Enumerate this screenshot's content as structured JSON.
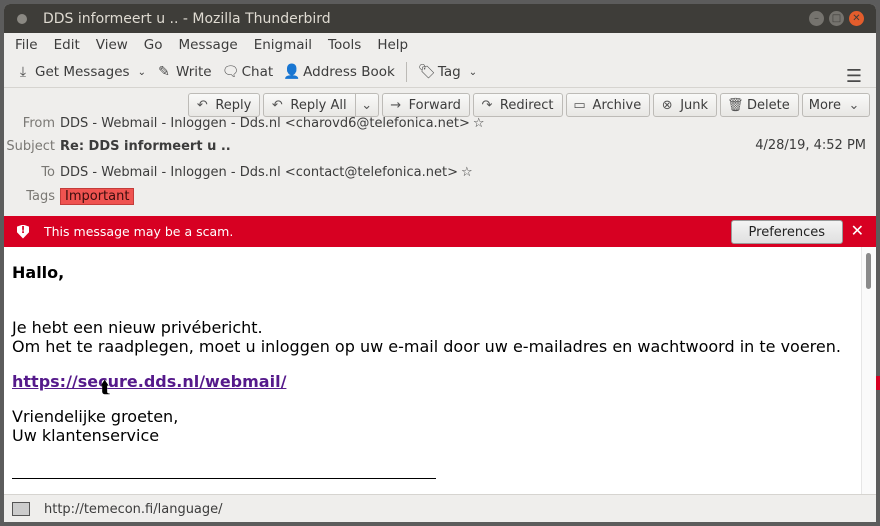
{
  "window": {
    "title": "DDS informeert u .. - Mozilla Thunderbird"
  },
  "menu": [
    "File",
    "Edit",
    "View",
    "Go",
    "Message",
    "Enigmail",
    "Tools",
    "Help"
  ],
  "toolbar": {
    "get_messages": "Get Messages",
    "write": "Write",
    "chat": "Chat",
    "address_book": "Address Book",
    "tag": "Tag"
  },
  "actions": {
    "reply": "Reply",
    "reply_all": "Reply All",
    "forward": "Forward",
    "redirect": "Redirect",
    "archive": "Archive",
    "junk": "Junk",
    "delete": "Delete",
    "more": "More"
  },
  "headers": {
    "from_label": "From",
    "from_value": "DDS - Webmail - Inloggen - Dds.nl <charovd6@telefonica.net>",
    "subject_label": "Subject",
    "subject_value": "Re: DDS informeert u ..",
    "date": "4/28/19, 4:52 PM",
    "to_label": "To",
    "to_value": "DDS - Webmail - Inloggen - Dds.nl <contact@telefonica.net>",
    "tags_label": "Tags",
    "tag_value": "Important"
  },
  "scam_bar": {
    "message": "This message may be a scam.",
    "preferences": "Preferences",
    "color": "#d70022"
  },
  "body": {
    "greeting": "Hallo,",
    "line1": "Je hebt een nieuw privébericht.",
    "line2": "Om het te raadplegen, moet u inloggen op uw e-mail door uw e-mailadres en wachtwoord in te voeren.",
    "link": "https://secure.dds.nl/webmail/",
    "closing1": "Vriendelijke groeten,",
    "closing2": "Uw klantenservice"
  },
  "status": {
    "url": "http://temecon.fi/language/"
  }
}
